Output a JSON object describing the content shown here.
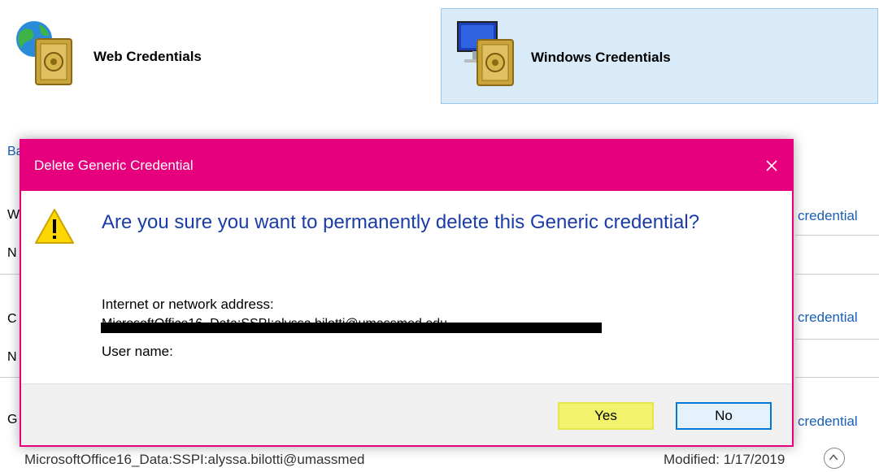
{
  "tiles": {
    "web": "Web Credentials",
    "windows": "Windows Credentials"
  },
  "background": {
    "left_letters": [
      "Ba",
      "W",
      "N",
      "C",
      "N",
      "G"
    ],
    "row_links": [
      "credential",
      "credential",
      "credential"
    ],
    "bottom_address": "MicrosoftOffice16_Data:SSPI:alyssa.bilotti@umassmed",
    "modified": "Modified:  1/17/2019"
  },
  "dialog": {
    "title": "Delete Generic Credential",
    "close_symbol": "✕",
    "question": "Are you sure you want to permanently delete this Generic credential?",
    "address_label": "Internet or network address:",
    "address_value": "MicrosoftOffice16_Data:SSPI:alyssa.bilotti@umassmed.edu",
    "user_label": "User name:",
    "yes_label": "Yes",
    "no_label": "No"
  },
  "colors": {
    "accent": "#e6007e",
    "question_text": "#1a3ca8",
    "link": "#1a5fb4",
    "highlight": "#f2f26d",
    "selected_tile": "#d9ebf9"
  },
  "icons": [
    "globe-vault-icon",
    "monitor-vault-icon",
    "warning-icon",
    "close-icon",
    "chevron-up-icon"
  ]
}
